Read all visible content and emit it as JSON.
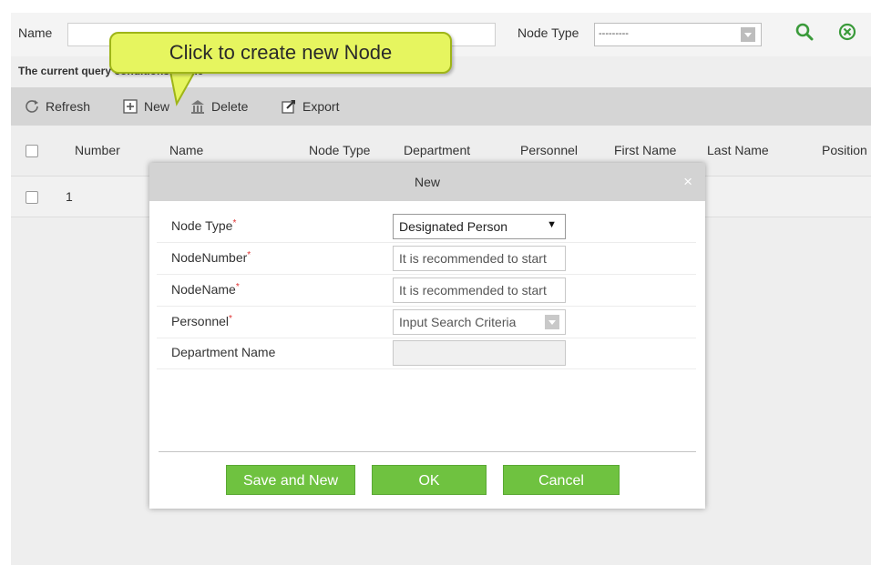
{
  "search": {
    "name_label": "Name",
    "node_type_label": "Node Type",
    "node_type_value": "---------",
    "search_icon": "search-icon",
    "clear_icon": "clear-circle-icon",
    "query_conditions": "The current query conditions: None"
  },
  "toolbar": {
    "refresh": "Refresh",
    "new": "New",
    "delete": "Delete",
    "export": "Export"
  },
  "table": {
    "columns": [
      "Number",
      "Name",
      "Node Type",
      "Department",
      "Personnel",
      "First Name",
      "Last Name",
      "Position"
    ],
    "rows": [
      {
        "number": "1"
      }
    ]
  },
  "callout": {
    "text": "Click to create new Node"
  },
  "dialog": {
    "title": "New",
    "close": "×",
    "fields": [
      {
        "label": "Node Type",
        "required": true,
        "value": "Designated Person",
        "type": "select"
      },
      {
        "label": "NodeNumber",
        "required": true,
        "placeholder": "It is recommended to start",
        "type": "input"
      },
      {
        "label": "NodeName",
        "required": true,
        "placeholder": "It is recommended to start",
        "type": "input"
      },
      {
        "label": "Personnel",
        "required": true,
        "value": "Input Search Criteria",
        "type": "combo"
      },
      {
        "label": "Department Name",
        "required": false,
        "value": "",
        "type": "disabled"
      }
    ],
    "buttons": {
      "save_new": "Save and New",
      "ok": "OK",
      "cancel": "Cancel"
    }
  },
  "colors": {
    "button_green": "#6fc240",
    "callout_yellow": "#e6f55f",
    "search_green": "#3a9a3a",
    "required_red": "#e03030"
  }
}
